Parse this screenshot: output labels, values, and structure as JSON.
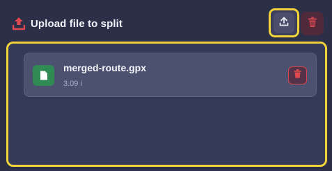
{
  "header": {
    "title": "Upload file to split",
    "icons": {
      "title_icon": "upload-icon",
      "upload_button_icon": "upload-icon",
      "delete_all_icon": "trash-icon"
    }
  },
  "files": [
    {
      "name": "merged-route.gpx",
      "size": "3.09 i",
      "icon": "file-icon",
      "delete_icon": "trash-icon"
    }
  ],
  "colors": {
    "highlight": "#f2d43a",
    "accent_red": "#e04a4f",
    "file_icon_bg": "#2f8a54",
    "background": "#2b2f48"
  }
}
